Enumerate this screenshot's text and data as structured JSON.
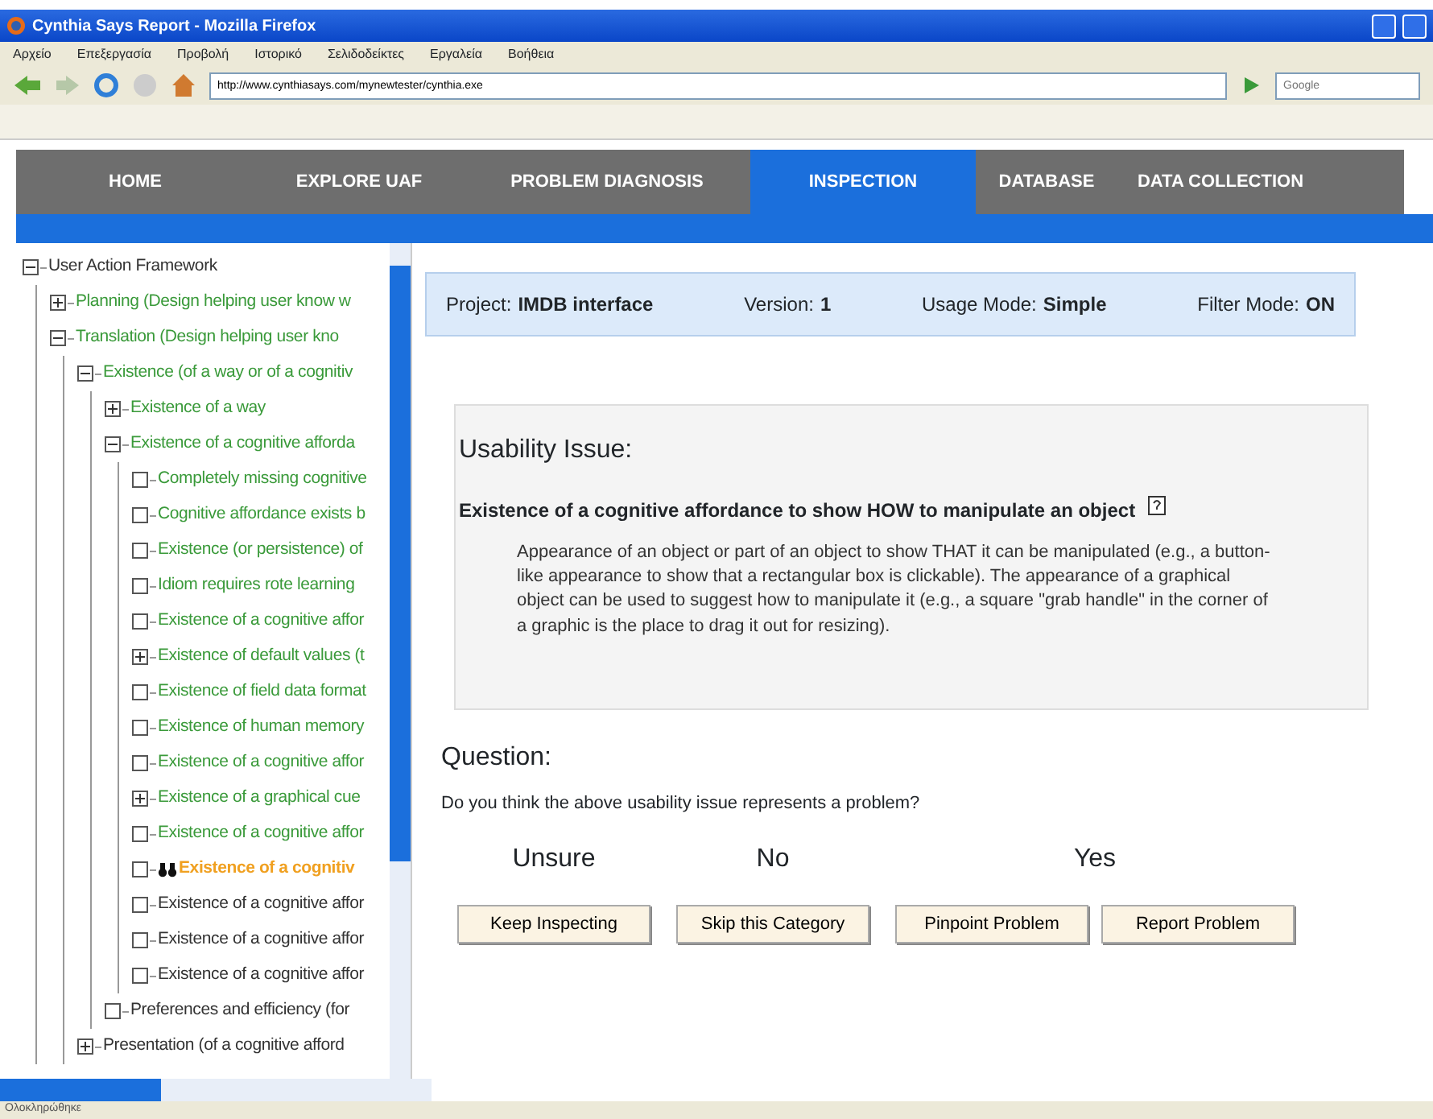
{
  "window": {
    "title": "Cynthia Says Report - Mozilla Firefox"
  },
  "menu": [
    "Αρχείο",
    "Επεξεργασία",
    "Προβολή",
    "Ιστορικό",
    "Σελιδοδείκτες",
    "Εργαλεία",
    "Βοήθεια"
  ],
  "address": {
    "value": "http://www.cynthiasays.com/mynewtester/cynthia.exe"
  },
  "search": {
    "placeholder": "Google"
  },
  "nav_tabs": [
    {
      "label": "HOME",
      "selected": false
    },
    {
      "label": "EXPLORE UAF",
      "selected": false
    },
    {
      "label": "PROBLEM DIAGNOSIS",
      "selected": false
    },
    {
      "label": "INSPECTION",
      "selected": true
    },
    {
      "label": "DATABASE",
      "selected": false
    },
    {
      "label": "DATA COLLECTION",
      "selected": false
    }
  ],
  "tree": [
    {
      "label": "User Action Framework",
      "kind": "expanded",
      "color": "#333333",
      "selected": false,
      "children": [
        {
          "label": "Planning (Design helping user know w",
          "kind": "collapsed",
          "color": "#3a9a3a",
          "selected": false
        },
        {
          "label": "Translation (Design helping user kno",
          "kind": "expanded",
          "color": "#3a9a3a",
          "selected": false,
          "children": [
            {
              "label": "Existence (of a way or of a cognitiv",
              "kind": "expanded",
              "color": "#3a9a3a",
              "selected": false,
              "children": [
                {
                  "label": "Existence of a way",
                  "kind": "collapsed",
                  "color": "#3a9a3a",
                  "selected": false
                },
                {
                  "label": "Existence of a cognitive afforda",
                  "kind": "expanded",
                  "color": "#3a9a3a",
                  "selected": false,
                  "children": [
                    {
                      "label": "Completely missing cognitive",
                      "kind": "leaf",
                      "color": "#3a9a3a",
                      "selected": false
                    },
                    {
                      "label": "Cognitive affordance exists b",
                      "kind": "leaf",
                      "color": "#3a9a3a",
                      "selected": false
                    },
                    {
                      "label": "Existence (or persistence) of",
                      "kind": "leaf",
                      "color": "#3a9a3a",
                      "selected": false
                    },
                    {
                      "label": "Idiom requires rote learning",
                      "kind": "leaf",
                      "color": "#3a9a3a",
                      "selected": false
                    },
                    {
                      "label": "Existence of a cognitive affor",
                      "kind": "leaf",
                      "color": "#3a9a3a",
                      "selected": false
                    },
                    {
                      "label": "Existence of default values (t",
                      "kind": "collapsed",
                      "color": "#3a9a3a",
                      "selected": false
                    },
                    {
                      "label": "Existence of field data format",
                      "kind": "leaf",
                      "color": "#3a9a3a",
                      "selected": false
                    },
                    {
                      "label": "Existence of human memory",
                      "kind": "leaf",
                      "color": "#3a9a3a",
                      "selected": false
                    },
                    {
                      "label": "Existence of a cognitive affor",
                      "kind": "leaf",
                      "color": "#3a9a3a",
                      "selected": false
                    },
                    {
                      "label": "Existence of a graphical cue",
                      "kind": "collapsed",
                      "color": "#3a9a3a",
                      "selected": false
                    },
                    {
                      "label": "Existence of a cognitive affor",
                      "kind": "leaf",
                      "color": "#3a9a3a",
                      "selected": false
                    },
                    {
                      "label": "Existence of a cognitiv",
                      "kind": "leaf",
                      "color": "#f0a020",
                      "selected": true
                    },
                    {
                      "label": "Existence of a cognitive affor",
                      "kind": "leaf",
                      "color": "#333333",
                      "selected": false
                    },
                    {
                      "label": "Existence of a cognitive affor",
                      "kind": "leaf",
                      "color": "#333333",
                      "selected": false
                    },
                    {
                      "label": "Existence of a cognitive affor",
                      "kind": "leaf",
                      "color": "#333333",
                      "selected": false
                    }
                  ]
                },
                {
                  "label": "Preferences and efficiency (for",
                  "kind": "leaf",
                  "color": "#333333",
                  "selected": false
                }
              ]
            },
            {
              "label": "Presentation (of a cognitive afford",
              "kind": "collapsed",
              "color": "#333333",
              "selected": false
            }
          ]
        }
      ]
    }
  ],
  "info": [
    {
      "label": "Project:",
      "value": "IMDB interface"
    },
    {
      "label": "Version:",
      "value": "1"
    },
    {
      "label": "Usage Mode:",
      "value": "Simple"
    },
    {
      "label": "Filter Mode:",
      "value": "ON"
    }
  ],
  "issue": {
    "heading": "Usability Issue:",
    "title": "Existence of a cognitive affordance to show HOW to manipulate an object",
    "description": "Appearance of an object or part of an object to show THAT it can be manipulated (e.g., a button-like appearance to show that a rectangular box is clickable). The appearance of a graphical object can be used to suggest how to manipulate it (e.g., a square \"grab handle\" in the corner of a graphic is the place to drag it out for resizing)."
  },
  "question": {
    "heading": "Question:",
    "text": "Do you think the above usability issue represents a problem?",
    "answers": [
      {
        "label": "Unsure",
        "buttons": [
          "Keep Inspecting"
        ]
      },
      {
        "label": "No",
        "buttons": [
          "Skip this Category"
        ]
      },
      {
        "label": "Yes",
        "buttons": [
          "Pinpoint Problem",
          "Report Problem"
        ]
      }
    ]
  },
  "status_bar": "Ολοκληρώθηκε"
}
